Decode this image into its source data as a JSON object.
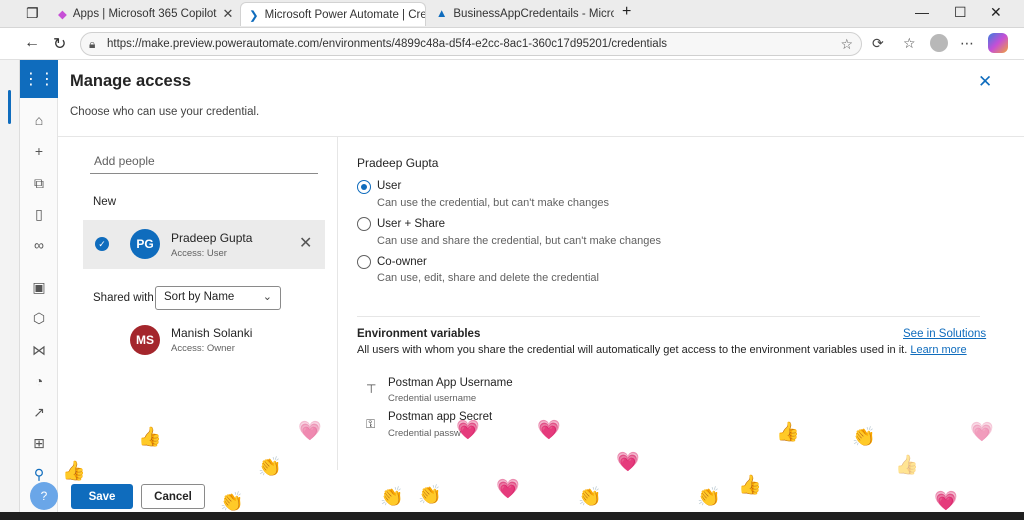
{
  "browser": {
    "tabs": [
      {
        "label": "Apps | Microsoft 365 Copilot"
      },
      {
        "label": "Microsoft Power Automate | Crec"
      },
      {
        "label": "BusinessAppCredentails - Micros"
      }
    ],
    "url": "https://make.preview.powerautomate.com/environments/4899c48a-d5f4-e2cc-8ac1-360c17d95201/credentials"
  },
  "panel": {
    "title": "Manage access",
    "subtitle": "Choose who can use your credential."
  },
  "people": {
    "add_placeholder": "Add people",
    "new_label": "New",
    "new_person": {
      "initials": "PG",
      "name": "Pradeep Gupta",
      "role": "Access: User",
      "avatar_color": "#0f6cbd"
    },
    "shared_with_label": "Shared with",
    "sort_value": "Sort by Name",
    "shared": [
      {
        "initials": "MS",
        "name": "Manish Solanki",
        "role": "Access: Owner",
        "avatar_color": "#a4262c"
      }
    ]
  },
  "permissions": {
    "selected_name": "Pradeep Gupta",
    "options": [
      {
        "label": "User",
        "desc": "Can use the credential, but can't make changes",
        "selected": true
      },
      {
        "label": "User + Share",
        "desc": "Can use and share the credential, but can't make changes",
        "selected": false
      },
      {
        "label": "Co-owner",
        "desc": "Can use, edit, share and delete the credential",
        "selected": false
      }
    ]
  },
  "env": {
    "title": "Environment variables",
    "link": "See in Solutions",
    "desc": "All users with whom you share the credential will automatically get access to the environment variables used in it.",
    "learn_more": "Learn more",
    "vars": [
      {
        "name": "Postman App Username",
        "desc": "Credential username",
        "icon": "text-field-icon"
      },
      {
        "name": "Postman app Secret",
        "desc": "Credential passw",
        "icon": "key-icon"
      }
    ]
  },
  "footer": {
    "save": "Save",
    "cancel": "Cancel"
  },
  "colors": {
    "accent": "#0f6cbd"
  },
  "reactions": [
    "👍",
    "💗",
    "👏"
  ]
}
